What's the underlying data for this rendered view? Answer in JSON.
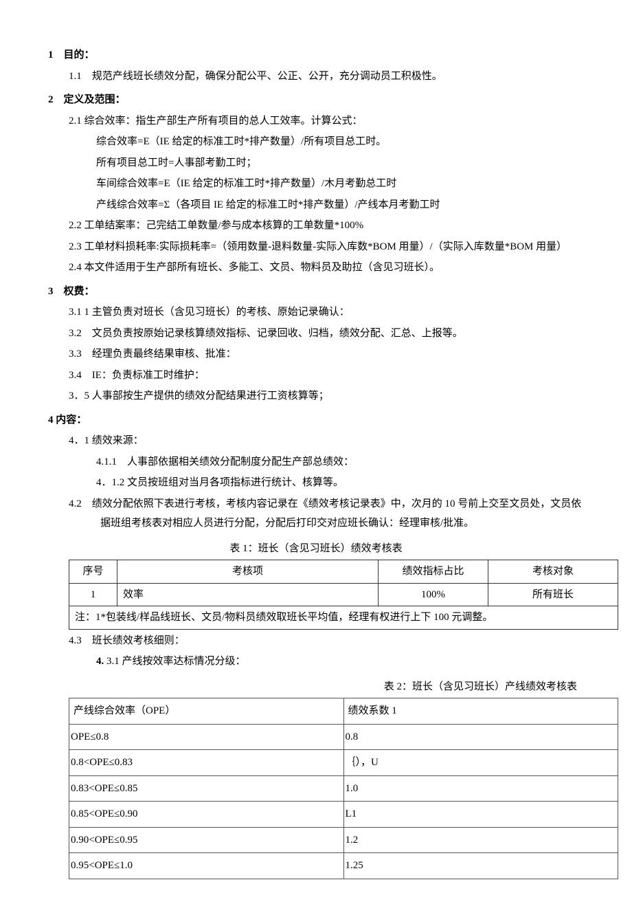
{
  "s1": {
    "h": "1　目的：",
    "p1": "1.1　规范产线班长绩效分配，确保分配公平、公正、公开，充分调动员工积极性。"
  },
  "s2": {
    "h": "2　定义及范围：",
    "p1": "2.1 综合效率：指生产部生产所有项目的总人工效率。计算公式：",
    "p1a": "综合效率=E（IE 给定的标准工时*排产数量）/所有项目总工时。",
    "p1b": "所有项目总工时=人事部考勤工时；",
    "p1c": "车间综合效率=E（IE 给定的标准工时*排产数量）/木月考勤总工时",
    "p1d": "产线综合效率=Σ（各项目 IE 给定的标准工时*排产数量）/产线本月考勤工时",
    "p2": "2.2 工单结案率：己完结工单数量/参与成本核算的工单数量*100%",
    "p3": "2.3 工单材料损耗率:实际损耗率=（领用数量-退料数量-实际入库数*BOM 用量）/（实际入库数量*BOM 用量）",
    "p4": "2.4 本文件适用于生产部所有班长、多能工、文员、物料员及助拉（含见习班长）。"
  },
  "s3": {
    "h": "3　权费：",
    "p1": "3.1 1 主管负责对班长（含见习班长）的考核、原始记录确认：",
    "p2": "3.2　文员负责按原始记录核算绩效指标、记录回收、归档，绩效分配、汇总、上报等。",
    "p3": "3.3　经理负责最终结果审核、批准：",
    "p4": "3.4　IE：负责标准工时维护：",
    "p5": "3．5 人事部按生产提供的绩效分配结果进行工资核算等；"
  },
  "s4": {
    "h": "4 内容：",
    "p1": "4．1 绩效来源：",
    "p1a": "4.1.1　人事部依据相关绩效分配制度分配生产部总绩效：",
    "p1b": "4．1.2 文员按班组对当月各项指标进行统计、核算等。",
    "p2": "4.2　绩效分配依照下表进行考核，考核内容记录在《绩效考核记录表》中，次月的 10 号前上交至文员处，文员依据班组考核表对相应人员进行分配，分配后打印交对应班长确认：经理审核/批准。",
    "t1title": "表 1：班长（含见习班长）绩效考核表",
    "t1": {
      "h1": "序号",
      "h2": "考核项",
      "h3": "绩效指标占比",
      "h4": "考核对象",
      "r1c1": "1",
      "r1c2": "效率",
      "r1c3": "100%",
      "r1c4": "所有班长",
      "note": "注：1*包装线/样品线班长、文员/物料员绩效取班长平均值，经理有权进行上下 100 元调整。"
    },
    "p3": "4.3　班长绩效考核细则：",
    "p3a_pre": "4.",
    "p3a": "3.1 产线按效率达标情况分级：",
    "t2title": "表 2：班长（含见习班长）产线绩效考核表",
    "t2": {
      "h1": "产线综合效率（OPE）",
      "h2": "绩效系数 1",
      "r1c1": "OPE≤0.8",
      "r1c2": "0.8",
      "r2c1": "0.8<OPE≤0.83",
      "r2c2": "｛），U",
      "r3c1": "0.83<OPE≤0.85",
      "r3c2": "1.0",
      "r4c1": "0.85<OPE≤0.90",
      "r4c2": "L1",
      "r5c1": "0.90<OPE≤0.95",
      "r5c2": "1.2",
      "r6c1": "0.95<OPE≤1.0",
      "r6c2": "1.25"
    }
  },
  "chart_data": [
    {
      "type": "table",
      "title": "表1：班长（含见习班长）绩效考核表",
      "columns": [
        "序号",
        "考核项",
        "绩效指标占比",
        "考核对象"
      ],
      "rows": [
        [
          "1",
          "效率",
          "100%",
          "所有班长"
        ]
      ],
      "note": "注：1*包装线/样品线班长、文员/物料员绩效取班长平均值，经理有权进行上下100元调整。"
    },
    {
      "type": "table",
      "title": "表2：班长（含见习班长）产线绩效考核表",
      "columns": [
        "产线综合效率（OPE）",
        "绩效系数1"
      ],
      "rows": [
        [
          "OPE≤0.8",
          "0.8"
        ],
        [
          "0.8<OPE≤0.83",
          "｛），U"
        ],
        [
          "0.83<OPE≤0.85",
          "1.0"
        ],
        [
          "0.85<OPE≤0.90",
          "L1"
        ],
        [
          "0.90<OPE≤0.95",
          "1.2"
        ],
        [
          "0.95<OPE≤1.0",
          "1.25"
        ]
      ]
    }
  ]
}
